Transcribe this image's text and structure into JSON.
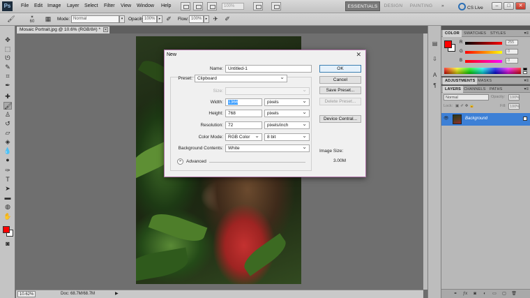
{
  "menubar": {
    "logo": "Ps",
    "items": [
      "File",
      "Edit",
      "Image",
      "Layer",
      "Select",
      "Filter",
      "View",
      "Window",
      "Help"
    ],
    "zoom_value": "100%",
    "workspaces": [
      "ESSENTIALS",
      "DESIGN",
      "PAINTING"
    ],
    "overflow": "»",
    "cs_live": "CS Live"
  },
  "options": {
    "brush_size": "60",
    "mode_label": "Mode:",
    "mode_value": "Normal",
    "opacity_label": "Opacity:",
    "opacity_value": "100%",
    "flow_label": "Flow:",
    "flow_value": "100%"
  },
  "document": {
    "tab_title": "Mosaic Portrait.jpg @ 10.6% (RGB/8#) *",
    "zoom": "10.62%",
    "doc_info": "Doc: 68.7M/68.7M"
  },
  "dialog": {
    "title": "New",
    "name_label": "Name:",
    "name_value": "Untitled-1",
    "preset_label": "Preset:",
    "preset_value": "Clipboard",
    "size_label": "Size:",
    "width_label": "Width:",
    "width_value": "1366",
    "width_unit": "pixels",
    "height_label": "Height:",
    "height_value": "768",
    "height_unit": "pixels",
    "resolution_label": "Resolution:",
    "resolution_value": "72",
    "resolution_unit": "pixels/inch",
    "colormode_label": "Color Mode:",
    "colormode_value": "RGB Color",
    "bitdepth_value": "8 bit",
    "background_label": "Background Contents:",
    "background_value": "White",
    "advanced_label": "Advanced",
    "buttons": {
      "ok": "OK",
      "cancel": "Cancel",
      "save_preset": "Save Preset...",
      "delete_preset": "Delete Preset...",
      "device_central": "Device Central..."
    },
    "image_size_label": "Image Size:",
    "image_size_value": "3.00M"
  },
  "panels": {
    "color_tabs": [
      "COLOR",
      "SWATCHES",
      "STYLES"
    ],
    "color_channels": [
      {
        "label": "R",
        "value": "255"
      },
      {
        "label": "G",
        "value": "0"
      },
      {
        "label": "B",
        "value": "0"
      }
    ],
    "adjust_tabs": [
      "ADJUSTMENTS",
      "MASKS"
    ],
    "layer_tabs": [
      "LAYERS",
      "CHANNELS",
      "PATHS"
    ],
    "blend_mode": "Normal",
    "opacity_label": "Opacity:",
    "opacity_value": "100%",
    "lock_label": "Lock:",
    "fill_label": "Fill:",
    "fill_value": "100%",
    "layer_name": "Background"
  },
  "colors": {
    "foreground": "#ff0000",
    "background": "#ffffff",
    "layer_selected": "#3d80d6"
  }
}
